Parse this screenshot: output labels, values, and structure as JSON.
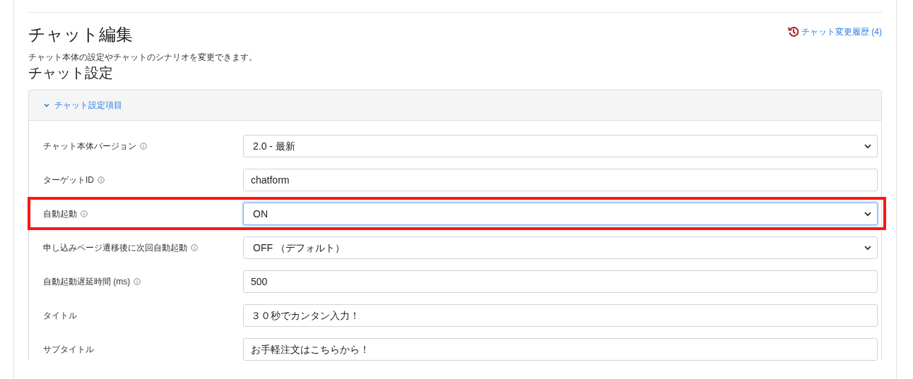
{
  "page": {
    "title": "チャット編集",
    "history_link": "チャット変更履歴 (4)",
    "description": "チャット本体の設定やチャットのシナリオを変更できます。",
    "section_title": "チャット設定"
  },
  "panel": {
    "header": "チャット設定項目",
    "expanded": true,
    "fields": [
      {
        "label": "チャット本体バージョン",
        "info": true,
        "kind": "select",
        "value": "2.0 - 最新",
        "focused": false,
        "highlighted": false
      },
      {
        "label": "ターゲットID",
        "info": true,
        "kind": "input",
        "value": "chatform",
        "focused": false,
        "highlighted": false
      },
      {
        "label": "自動起動",
        "info": true,
        "kind": "select",
        "value": "ON",
        "focused": true,
        "highlighted": true
      },
      {
        "label": "申し込みページ遷移後に次回自動起動",
        "info": true,
        "kind": "select",
        "value": "OFF （デフォルト）",
        "focused": false,
        "highlighted": false
      },
      {
        "label": "自動起動遅延時間 (ms)",
        "info": true,
        "kind": "input",
        "value": "500",
        "focused": false,
        "highlighted": false
      },
      {
        "label": "タイトル",
        "info": false,
        "kind": "input",
        "value": "３０秒でカンタン入力！",
        "focused": false,
        "highlighted": false
      },
      {
        "label": "サブタイトル",
        "info": false,
        "kind": "input",
        "value": "お手軽注文はこちらから！",
        "focused": false,
        "highlighted": false
      }
    ]
  }
}
